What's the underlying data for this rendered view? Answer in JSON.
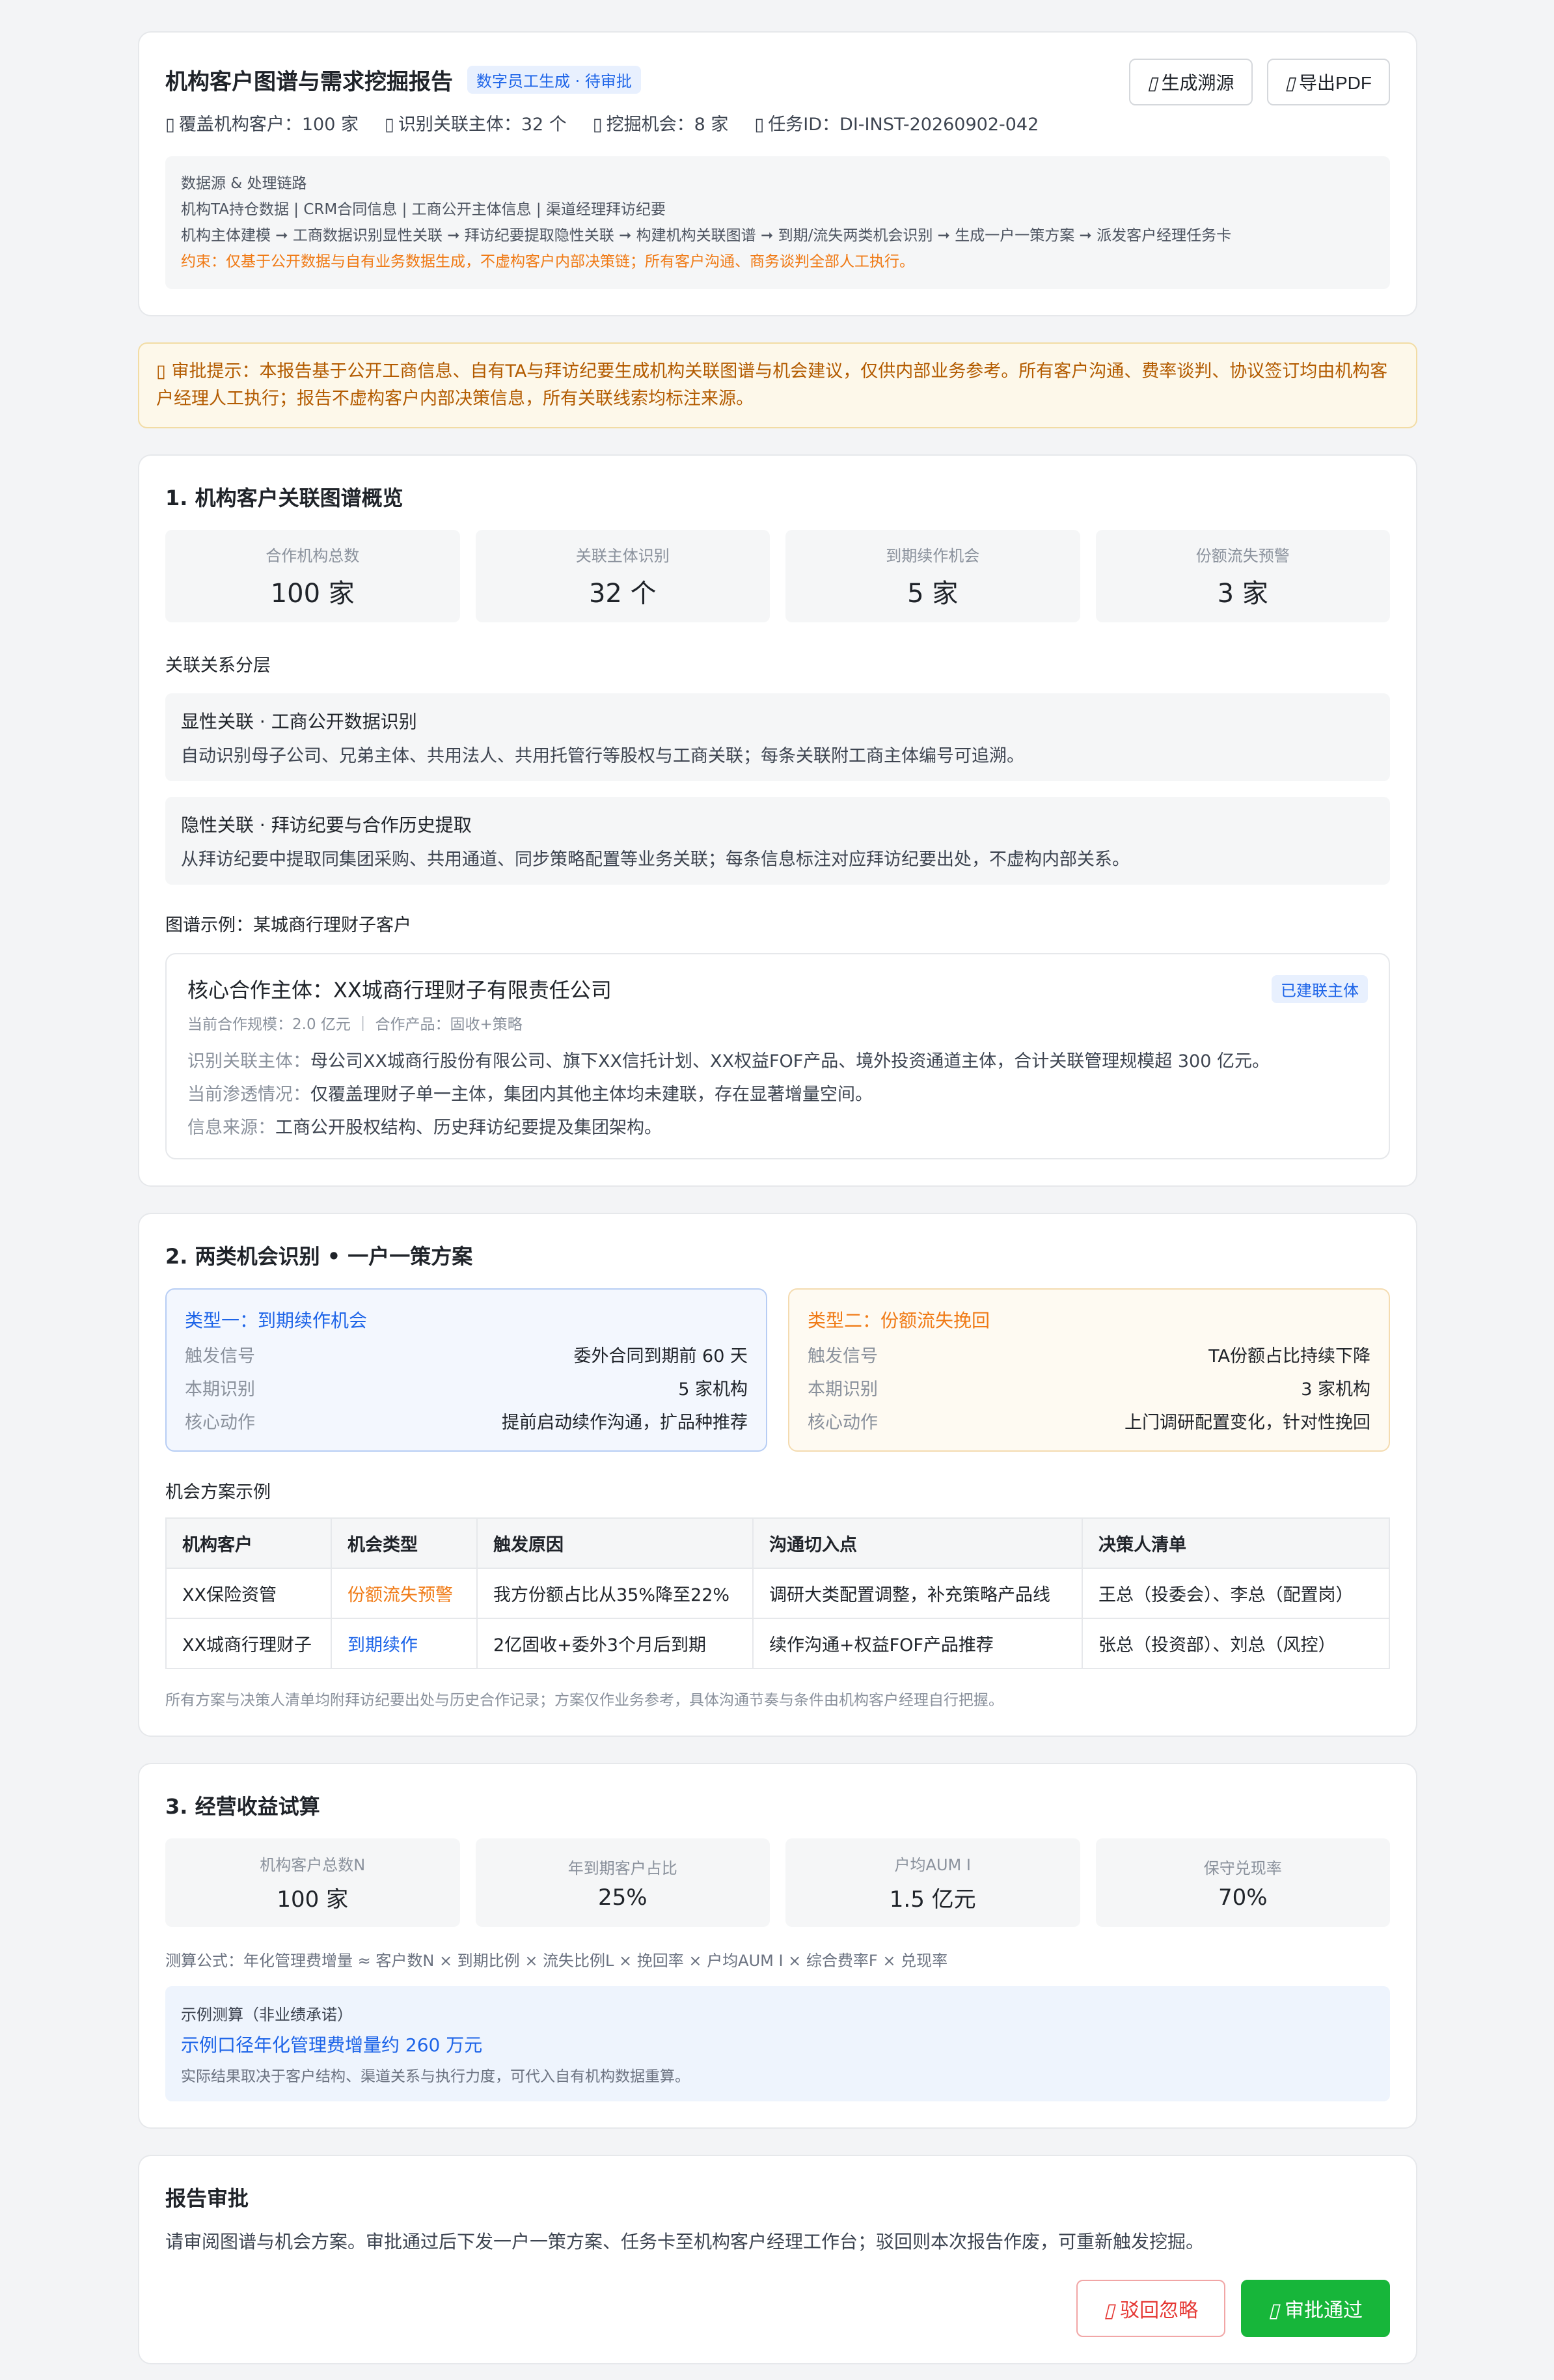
{
  "header": {
    "title": "机构客户图谱与需求挖掘报告",
    "badge": "数字员工生成 · 待审批",
    "meta": [
      {
        "icon": "▯",
        "text": "覆盖机构客户：100 家"
      },
      {
        "icon": "▯",
        "text": "识别关联主体：32 个"
      },
      {
        "icon": "▯",
        "text": "挖掘机会：8 家"
      },
      {
        "icon": "▯",
        "text": "任务ID：DI-INST-20260902-042"
      }
    ],
    "btn_trace": "生成溯源",
    "btn_pdf": "导出PDF",
    "btn_icon": "▯",
    "source_title": "数据源 & 处理链路",
    "source_list": "机构TA持仓数据 | CRM合同信息 | 工商公开主体信息 | 渠道经理拜访纪要",
    "source_chain": "机构主体建模 ➞ 工商数据识别显性关联 ➞ 拜访纪要提取隐性关联 ➞ 构建机构关联图谱 ➞ 到期/流失两类机会识别 ➞ 生成一户一策方案 ➞ 派发客户经理任务卡",
    "source_warn": "约束：仅基于公开数据与自有业务数据生成，不虚构客户内部决策链；所有客户沟通、商务谈判全部人工执行。"
  },
  "alert": "▯ 审批提示：本报告基于公开工商信息、自有TA与拜访纪要生成机构关联图谱与机会建议，仅供内部业务参考。所有客户沟通、费率谈判、协议签订均由机构客户经理人工执行；报告不虚构客户内部决策信息，所有关联线索均标注来源。",
  "sec1": {
    "title": "1. 机构客户关联图谱概览",
    "stats": [
      {
        "label": "合作机构总数",
        "value": "100 家"
      },
      {
        "label": "关联主体识别",
        "value": "32 个"
      },
      {
        "label": "到期续作机会",
        "value": "5 家"
      },
      {
        "label": "份额流失预警",
        "value": "3 家"
      }
    ],
    "layers_title": "关联关系分层",
    "layers": [
      {
        "title": "显性关联 · 工商公开数据识别",
        "desc": "自动识别母子公司、兄弟主体、共用法人、共用托管行等股权与工商关联；每条关联附工商主体编号可追溯。"
      },
      {
        "title": "隐性关联 · 拜访纪要与合作历史提取",
        "desc": "从拜访纪要中提取同集团采购、共用通道、同步策略配置等业务关联；每条信息标注对应拜访纪要出处，不虚构内部关系。"
      }
    ],
    "example_title": "图谱示例：某城商行理财子客户",
    "example": {
      "name": "核心合作主体：XX城商行理财子有限责任公司",
      "tag": "已建联主体",
      "scale": "当前合作规模：2.0 亿元 ｜ 合作产品：固收+策略",
      "line1_k": "识别关联主体：",
      "line1_v": "母公司XX城商行股份有限公司、旗下XX信托计划、XX权益FOF产品、境外投资通道主体，合计关联管理规模超 300 亿元。",
      "line2_k": "当前渗透情况：",
      "line2_v": "仅覆盖理财子单一主体，集团内其他主体均未建联，存在显著增量空间。",
      "line3_k": "信息来源：",
      "line3_v": "工商公开股权结构、历史拜访纪要提及集团架构。"
    }
  },
  "sec2": {
    "title": "2. 两类机会识别 • 一户一策方案",
    "type1": {
      "title": "类型一：到期续作机会",
      "rows": [
        {
          "k": "触发信号",
          "v": "委外合同到期前 60 天"
        },
        {
          "k": "本期识别",
          "v": "5 家机构"
        },
        {
          "k": "核心动作",
          "v": "提前启动续作沟通，扩品种推荐"
        }
      ]
    },
    "type2": {
      "title": "类型二：份额流失挽回",
      "rows": [
        {
          "k": "触发信号",
          "v": "TA份额占比持续下降"
        },
        {
          "k": "本期识别",
          "v": "3 家机构"
        },
        {
          "k": "核心动作",
          "v": "上门调研配置变化，针对性挽回"
        }
      ]
    },
    "table_title": "机会方案示例",
    "table_headers": [
      "机构客户",
      "机会类型",
      "触发原因",
      "沟通切入点",
      "决策人清单"
    ],
    "table_rows": [
      {
        "client": "XX保险资管",
        "type": "份额流失预警",
        "reason": "我方份额占比从35%降至22%",
        "entry": "调研大类配置调整，补充策略产品线",
        "people": "王总（投委会）、李总（配置岗）"
      },
      {
        "client": "XX城商行理财子",
        "type": "到期续作",
        "reason": "2亿固收+委外3个月后到期",
        "entry": "续作沟通+权益FOF产品推荐",
        "people": "张总（投资部）、刘总（风控）"
      }
    ],
    "note": "所有方案与决策人清单均附拜访纪要出处与历史合作记录；方案仅作业务参考，具体沟通节奏与条件由机构客户经理自行把握。"
  },
  "sec3": {
    "title": "3. 经营收益试算",
    "stats": [
      {
        "label": "机构客户总数N",
        "value": "100 家"
      },
      {
        "label": "年到期客户占比",
        "value": "25%"
      },
      {
        "label": "户均AUM I",
        "value": "1.5 亿元"
      },
      {
        "label": "保守兑现率",
        "value": "70%"
      }
    ],
    "formula": "测算公式：年化管理费增量 ≈ 客户数N × 到期比例 × 流失比例L × 挽回率 × 户均AUM I × 综合费率F × 兑现率",
    "calc_label": "示例测算（非业绩承诺）",
    "calc_result": "示例口径年化管理费增量约 260 万元",
    "calc_note": "实际结果取决于客户结构、渠道关系与执行力度，可代入自有机构数据重算。"
  },
  "approval": {
    "title": "报告审批",
    "desc": "请审阅图谱与机会方案。审批通过后下发一户一策方案、任务卡至机构客户经理工作台；驳回则本次报告作废，可重新触发挖掘。",
    "reject": "驳回忽略",
    "approve": "审批通过",
    "icon": "▯"
  },
  "colors": {
    "accent_blue": "#1d64e8",
    "accent_orange": "#f07a15",
    "approve_green": "#17b63a",
    "reject_red": "#e53935"
  }
}
